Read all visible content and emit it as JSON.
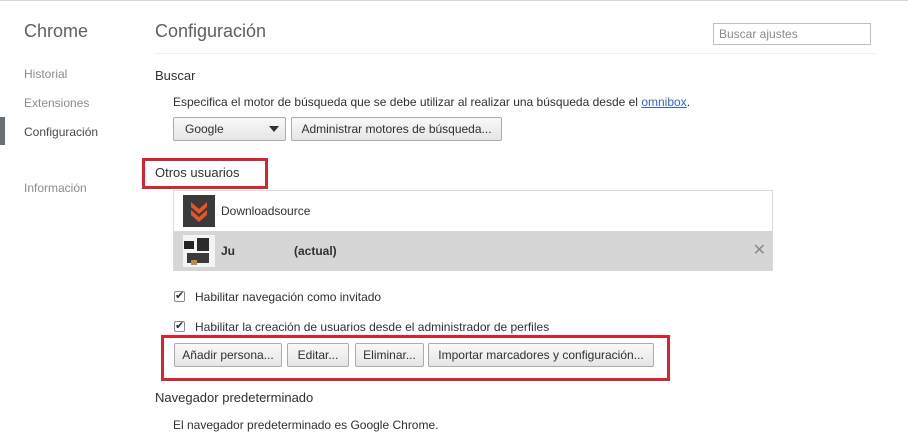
{
  "sidebar": {
    "title": "Chrome",
    "items": [
      {
        "label": "Historial"
      },
      {
        "label": "Extensiones"
      },
      {
        "label": "Configuración"
      },
      {
        "label": "Información"
      }
    ]
  },
  "header": {
    "title": "Configuración",
    "search_placeholder": "Buscar ajustes"
  },
  "search_section": {
    "title": "Buscar",
    "description": "Especifica el motor de búsqueda que se debe utilizar al realizar una búsqueda desde el",
    "link": "omnibox",
    "link_suffix": ".",
    "engine_selected": "Google",
    "manage_button": "Administrar motores de búsqueda..."
  },
  "users_section": {
    "title": "Otros usuarios",
    "users": [
      {
        "name": "Downloadsource",
        "status": ""
      },
      {
        "name": "Ju",
        "status": "(actual)"
      }
    ],
    "remove_symbol": "✕",
    "guest_checkbox": {
      "label": "Habilitar navegación como invitado",
      "checked": true
    },
    "supervised_checkbox": {
      "label": "Habilitar la creación de usuarios desde el administrador de perfiles",
      "checked": true
    },
    "buttons": {
      "add": "Añadir persona...",
      "edit": "Editar...",
      "delete": "Eliminar...",
      "import": "Importar marcadores y configuración..."
    }
  },
  "default_browser": {
    "title": "Navegador predeterminado",
    "text": "El navegador predeterminado es Google Chrome."
  },
  "colors": {
    "highlight": "#d9232e",
    "link": "#3366cc",
    "selected_row": "#d6d6d6",
    "downloadsource_logo": "#e8542a"
  }
}
